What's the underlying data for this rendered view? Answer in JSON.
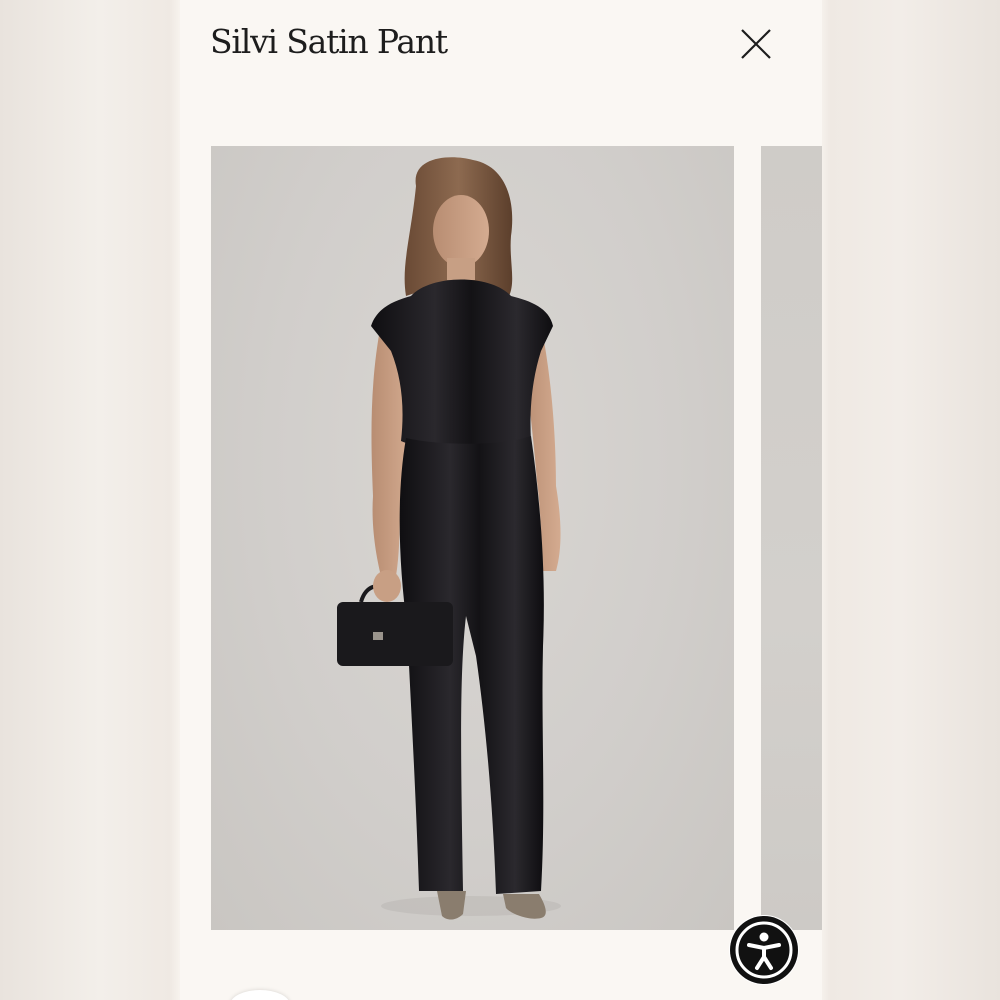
{
  "modal": {
    "title": "Silvi Satin Pant"
  },
  "icons": {
    "close": "close-icon",
    "accessibility": "accessibility-icon"
  },
  "colors": {
    "background": "#faf7f3",
    "text": "#1d1d1d",
    "photo_background": "#d4d1cd",
    "garment": "#151417"
  },
  "gallery": {
    "images": [
      {
        "alt": "model-wearing-black-satin-top-and-pants"
      },
      {
        "alt": "next-image-partial"
      }
    ]
  }
}
